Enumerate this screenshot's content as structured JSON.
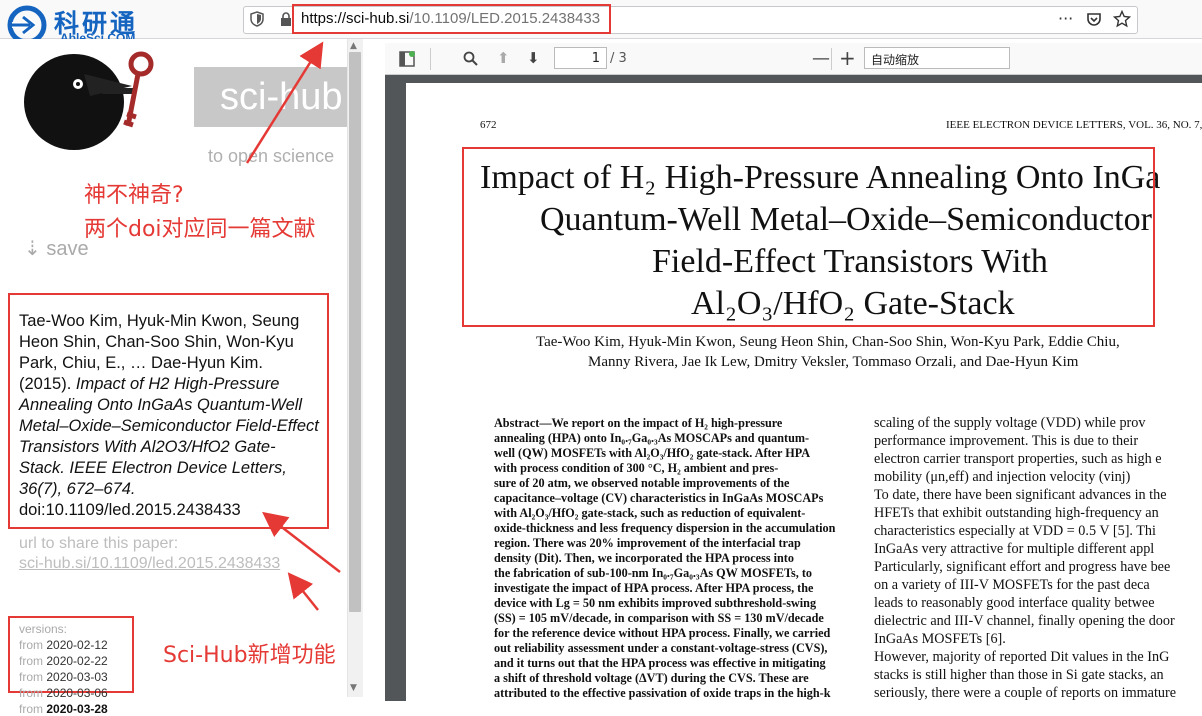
{
  "browser": {
    "url_host": "https://sci-hub.si",
    "url_path": "/10.1109/LED.2015.2438433",
    "toolbar_icons": [
      "shield-icon",
      "lock-icon",
      "more-icon",
      "pocket-icon",
      "star-icon"
    ]
  },
  "logo": {
    "main": "科研通",
    "sub": "AbleSci.COM"
  },
  "scihub": {
    "brand": "sci-hub",
    "tagline": "to open science",
    "save": "⇣ save"
  },
  "annotations": {
    "note1": "神不神奇?",
    "note2": "两个doi对应同一篇文献",
    "note3": "Sci-Hub新增功能",
    "accent": "#e53935"
  },
  "citation": {
    "authors": "Tae-Woo Kim, Hyuk-Min Kwon, Seung Heon Shin, Chan-Soo Shin, Won-Kyu Park, Chiu, E., … Dae-Hyun Kim. (2015).",
    "title": "Impact of H2 High-Pressure Annealing Onto InGaAs Quantum-Well Metal–Oxide–Semiconductor Field-Effect Transistors With Al2O3/HfO2 Gate-Stack. IEEE Electron Device Letters, 36(7), 672–674.",
    "doi": "doi:10.1109/led.2015.2438433"
  },
  "share": {
    "label": "url to share this paper:",
    "link": "sci-hub.si/10.1109/led.2015.2438433"
  },
  "versions": {
    "title": "versions:",
    "items": [
      {
        "prefix": "from",
        "date": "2020-02-12"
      },
      {
        "prefix": "from",
        "date": "2020-02-22"
      },
      {
        "prefix": "from",
        "date": "2020-03-03"
      },
      {
        "prefix": "from",
        "date": "2020-03-06"
      },
      {
        "prefix": "from",
        "date": "2020-03-28"
      }
    ]
  },
  "pdf": {
    "page": "1",
    "total": "/ 3",
    "zoom": "自动缩放",
    "page_number": "672",
    "journal": "IEEE ELECTRON DEVICE LETTERS, VOL. 36, NO. 7,",
    "title_lines": [
      "Impact of H₂ High-Pressure Annealing Onto InGa",
      "Quantum-Well Metal–Oxide–Semiconductor",
      "Field-Effect Transistors With",
      "Al₂O₃/HfO₂ Gate-Stack"
    ],
    "authors_lines": [
      "Tae-Woo Kim, Hyuk-Min Kwon, Seung Heon Shin, Chan-Soo Shin, Won-Kyu Park, Eddie Chiu,",
      "Manny Rivera, Jae Ik Lew, Dmitry Veksler, Tommaso Orzali, and Dae-Hyun Kim"
    ],
    "abstract_lines": [
      "Abstract—We report on the impact of H₂ high-pressure",
      "annealing (HPA) onto In₀.₇Ga₀.₃As MOSCAPs and quantum-",
      "well (QW) MOSFETs with Al₂O₃/HfO₂ gate-stack. After HPA",
      "with process condition of 300 °C, H₂ ambient and pres-",
      "sure of 20 atm, we observed notable improvements of the",
      "capacitance–voltage (CV) characteristics in InGaAs MOSCAPs",
      "with Al₂O₃/HfO₂ gate-stack, such as reduction of equivalent-",
      "oxide-thickness and less frequency dispersion in the accumulation",
      "region. There was 20% improvement of the interfacial trap",
      "density (Dit). Then, we incorporated the HPA process into",
      "the fabrication of sub-100-nm In₀.₇Ga₀.₃As QW MOSFETs, to",
      "investigate the impact of HPA process. After HPA process, the",
      "device with Lg = 50 nm exhibits improved subthreshold-swing",
      "(SS) = 105 mV/decade, in comparison with SS = 130 mV/decade",
      "for the reference device without HPA process. Finally, we carried",
      "out reliability assessment under a constant-voltage-stress (CVS),",
      "and it turns out that the HPA process was effective in mitigating",
      "a shift of threshold voltage (ΔVT) during the CVS. These are",
      "attributed to the effective passivation of oxide traps in the high-k"
    ],
    "body_lines": [
      "scaling of the supply voltage (VDD) while prov",
      "performance improvement. This is due to their",
      "electron carrier transport properties, such as high e",
      "mobility (μn,eff) and injection velocity (vinj)",
      "To date, there have been significant advances in the",
      "HFETs that exhibit outstanding high-frequency an",
      "characteristics especially at VDD = 0.5 V [5]. Thi",
      "InGaAs very attractive for multiple different appl",
      "Particularly, significant effort and progress have bee",
      "on a variety of III-V MOSFETs for the past deca",
      "leads to reasonably good interface quality betwee",
      "dielectric and III-V channel, finally opening the door",
      "InGaAs MOSFETs [6].",
      "   However, majority of reported Dit values in the InG",
      "stacks is still higher than those in Si gate stacks, an",
      "seriously, there were a couple of reports on immature"
    ]
  }
}
